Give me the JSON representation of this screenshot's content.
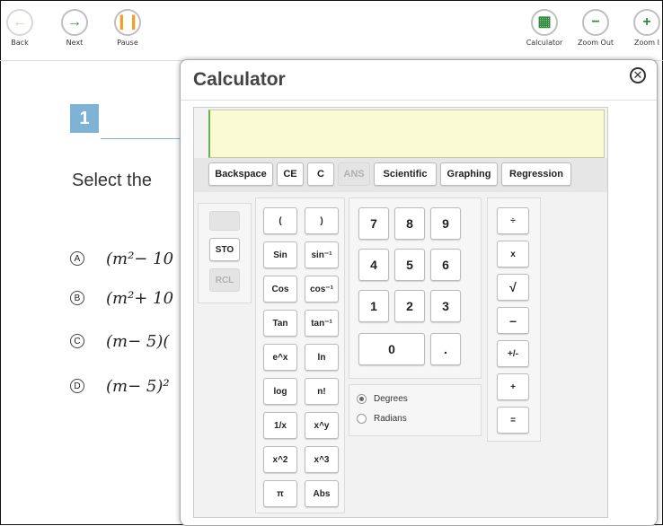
{
  "toolbar": {
    "back": "Back",
    "next": "Next",
    "pause": "Pause",
    "calculator": "Calculator",
    "zoom_out": "Zoom Out",
    "zoom_in": "Zoom I"
  },
  "question": {
    "number": "1",
    "prompt": "Select the",
    "options": [
      {
        "letter": "A",
        "text": "(m²− 10"
      },
      {
        "letter": "B",
        "text": "(m²+ 10"
      },
      {
        "letter": "C",
        "text": "(m− 5)("
      },
      {
        "letter": "D",
        "text": "(m− 5)²"
      }
    ]
  },
  "calculator": {
    "title": "Calculator",
    "display_value": "",
    "mode_buttons": [
      "Backspace",
      "CE",
      "C",
      "ANS",
      "Scientific",
      "Graphing",
      "Regression"
    ],
    "memory": [
      "STO",
      "RCL"
    ],
    "func_keys": [
      "(",
      ")",
      "Sin",
      "sin⁻¹",
      "Cos",
      "cos⁻¹",
      "Tan",
      "tan⁻¹",
      "e^x",
      "ln",
      "log",
      "n!",
      "1/x",
      "x^y",
      "x^2",
      "x^3",
      "π",
      "Abs"
    ],
    "digits": [
      "7",
      "8",
      "9",
      "4",
      "5",
      "6",
      "1",
      "2",
      "3",
      "0",
      "."
    ],
    "ops": [
      "÷",
      "x",
      "√",
      "–",
      "+/-",
      "+",
      "="
    ],
    "angle": {
      "degrees": "Degrees",
      "radians": "Radians",
      "selected": "Degrees"
    }
  },
  "colors": {
    "accent_green": "#2e8b3a",
    "pause_orange": "#f0a020",
    "question_badge": "#7fb3d5",
    "display_bg": "#fafbd4"
  }
}
